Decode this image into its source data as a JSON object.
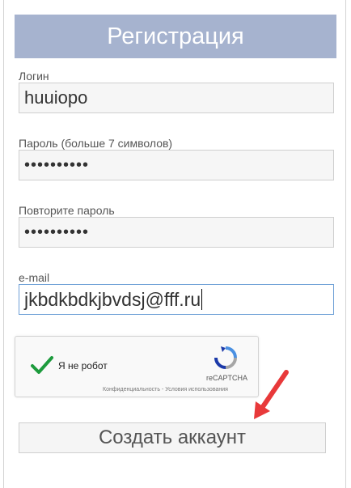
{
  "form": {
    "title": "Регистрация",
    "login_label": "Логин",
    "login_value": "huuiopo",
    "password_label": "Пароль (больше 7 символов)",
    "password_value": "••••••••••",
    "repeat_label": "Повторите пароль",
    "repeat_value": "••••••••••",
    "email_label": "e-mail",
    "email_value": "jkbdkbdkjbvdsj@fff.ru",
    "submit_label": "Создать аккаунт"
  },
  "captcha": {
    "label": "Я не робот",
    "brand": "reCAPTCHA",
    "links": "Конфиденциальность - Условия использования",
    "checked": true
  },
  "colors": {
    "header_bg": "#a6b3cf",
    "check": "#1d9b3d",
    "arrow": "#e8393a",
    "focus_border": "#6ea0d6"
  },
  "icons": {
    "check": "check-icon",
    "recaptcha": "recaptcha-logo-icon",
    "arrow": "red-arrow-icon"
  }
}
